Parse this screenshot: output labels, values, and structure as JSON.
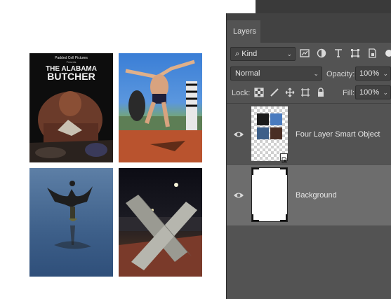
{
  "canvas": {
    "poster": {
      "company": "Padded Cell Pictures",
      "presents": "Presents",
      "title_line1": "THE ALABAMA",
      "title_line2": "BUTCHER"
    }
  },
  "layers_panel": {
    "tab_label": "Layers",
    "filter": {
      "kind_label": "Kind"
    },
    "blend_mode": "Normal",
    "opacity_label": "Opacity:",
    "opacity_value": "100%",
    "lock_label": "Lock:",
    "fill_label": "Fill:",
    "fill_value": "100%",
    "layers": [
      {
        "name": "Four Layer Smart Object",
        "visible": true,
        "type": "smart-object"
      },
      {
        "name": "Background",
        "visible": true,
        "type": "background",
        "selected": true
      }
    ]
  },
  "colors": {
    "panel_bg": "#535353",
    "panel_header": "#424242",
    "selected_layer": "#6d6d6d",
    "canvas_bg": "#ffffff"
  }
}
